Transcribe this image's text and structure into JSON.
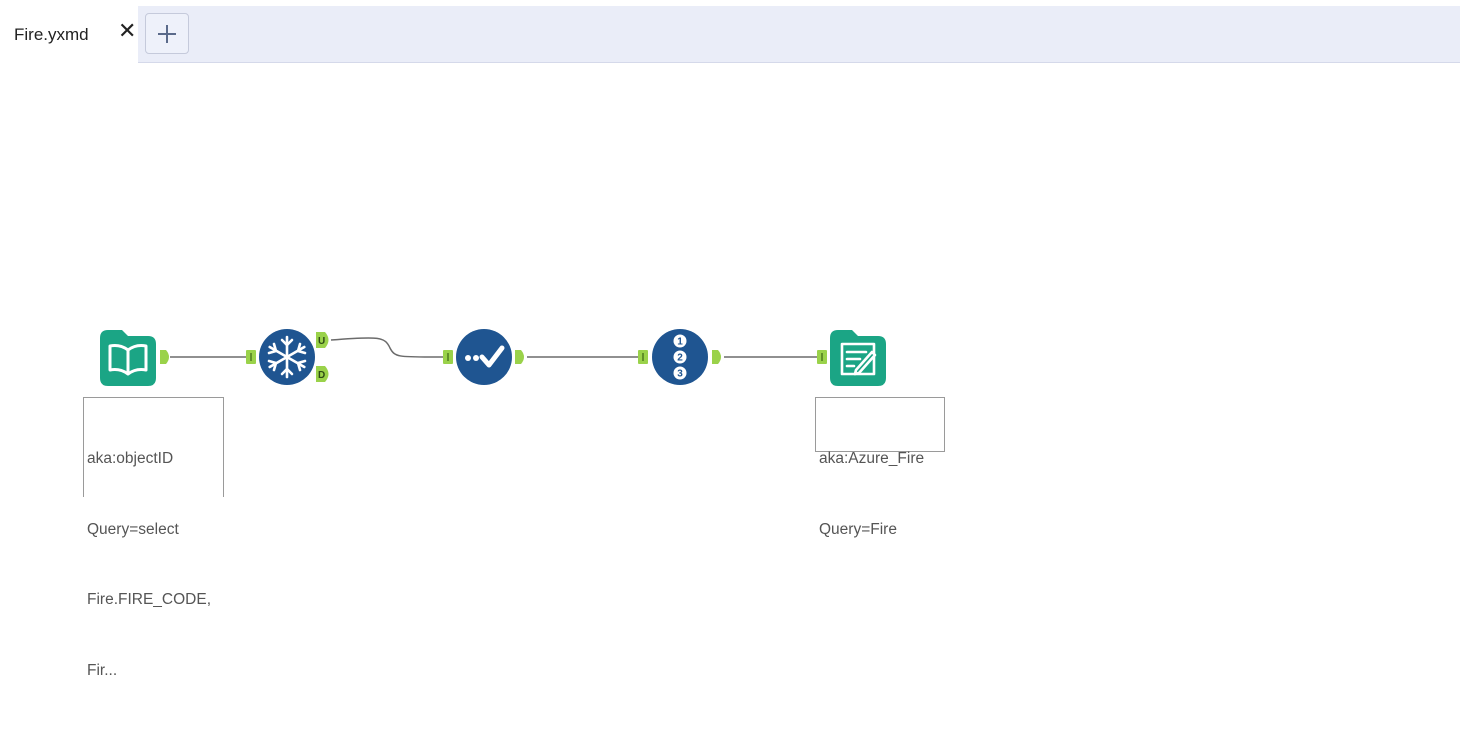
{
  "tabs": [
    {
      "label": "Fire.yxmd",
      "close_glyph": "✕"
    }
  ],
  "add_tab": {
    "icon": "plus-icon"
  },
  "tools": [
    {
      "name": "input-data-tool",
      "icon": "open-book-icon",
      "color": "#1ba585"
    },
    {
      "name": "unique-tool",
      "icon": "snowflake-icon",
      "color": "#1f5591",
      "outputs": [
        "U",
        "D"
      ]
    },
    {
      "name": "select-tool",
      "icon": "checkmark-icon",
      "color": "#1f5591"
    },
    {
      "name": "record-id-tool",
      "icon": "numbered-list-icon",
      "color": "#1f5591"
    },
    {
      "name": "output-data-tool",
      "icon": "document-edit-icon",
      "color": "#1ba585"
    }
  ],
  "annotations": {
    "input": [
      "aka:objectID",
      "Query=select",
      "Fire.FIRE_CODE,",
      "Fir..."
    ],
    "output": [
      "aka:Azure_Fire",
      "Query=Fire"
    ]
  },
  "anchor_labels": {
    "unique_output": "U",
    "duplicate_output": "D"
  },
  "colors": {
    "anchor": "#9ad24a",
    "wire": "#6b6b6b",
    "tab_strip": "#eaedf8"
  }
}
